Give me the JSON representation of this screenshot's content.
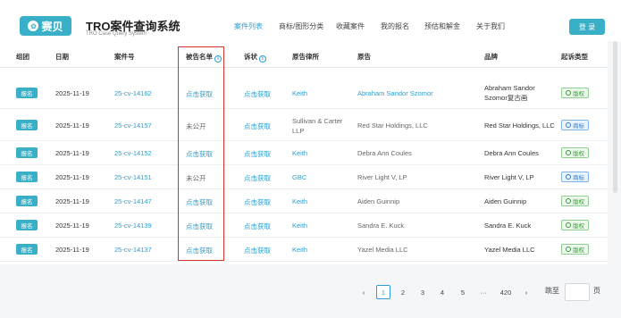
{
  "header": {
    "logo_text": "赛贝",
    "title": "TRO案件查询系统",
    "subtitle": "TRO Case Query System",
    "nav": [
      "案件列表",
      "商标/图形分类",
      "收藏案件",
      "我的报名",
      "预估和解金",
      "关于我们"
    ],
    "login": "登 录"
  },
  "table": {
    "headers": [
      "组团",
      "日期",
      "案件号",
      "被告名单",
      "诉状",
      "原告律所",
      "原告",
      "品牌",
      "起诉类型"
    ],
    "rows": [
      {
        "group": "报名",
        "date": "2025-11-19",
        "case": "25-cv-14162",
        "defendants": "点击获取",
        "complaint": "点击获取",
        "firm": "Keith",
        "plaintiff": "Abraham Sandor Szomor",
        "brand": "Abraham Sandor Szomor复古画",
        "type": "版权",
        "type_kind": "copyright"
      },
      {
        "group": "报名",
        "date": "2025-11-19",
        "case": "25-cv-14157",
        "defendants": "未公开",
        "complaint": "点击获取",
        "firm": "Sullivan & Carter LLP",
        "plaintiff": "Red Star Holdings, LLC",
        "brand": "Red Star Holdings, LLC",
        "type": "商标",
        "type_kind": "trademark"
      },
      {
        "group": "报名",
        "date": "2025-11-19",
        "case": "25-cv-14152",
        "defendants": "点击获取",
        "complaint": "点击获取",
        "firm": "Keith",
        "plaintiff": "Debra Ann Coules",
        "brand": "Debra Ann Coules",
        "type": "版权",
        "type_kind": "copyright"
      },
      {
        "group": "报名",
        "date": "2025-11-19",
        "case": "25-cv-14151",
        "defendants": "未公开",
        "complaint": "点击获取",
        "firm": "GBC",
        "plaintiff": "River Light V, LP",
        "brand": "River Light V, LP",
        "type": "商标",
        "type_kind": "trademark"
      },
      {
        "group": "报名",
        "date": "2025-11-19",
        "case": "25-cv-14147",
        "defendants": "点击获取",
        "complaint": "点击获取",
        "firm": "Keith",
        "plaintiff": "Aiden Guinnip",
        "brand": "Aiden Guinnip",
        "type": "版权",
        "type_kind": "copyright"
      },
      {
        "group": "报名",
        "date": "2025-11-19",
        "case": "25-cv-14139",
        "defendants": "点击获取",
        "complaint": "点击获取",
        "firm": "Keith",
        "plaintiff": "Sandra E. Kuck",
        "brand": "Sandra E. Kuck",
        "type": "版权",
        "type_kind": "copyright"
      },
      {
        "group": "报名",
        "date": "2025-11-19",
        "case": "25-cv-14137",
        "defendants": "点击获取",
        "complaint": "点击获取",
        "firm": "Keith",
        "plaintiff": "Yazel Media LLC",
        "brand": "Yazel Media LLC",
        "type": "版权",
        "type_kind": "copyright"
      }
    ]
  },
  "pagination": {
    "pages": [
      "1",
      "2",
      "3",
      "4",
      "5",
      "···",
      "420"
    ],
    "current": "1",
    "prev": "‹",
    "next": "›",
    "goto_label": "跳至",
    "page_unit": "页"
  },
  "colors": {
    "accent": "#3ab0c8",
    "link": "#2a9fd6",
    "highlight": "#d0342c"
  }
}
